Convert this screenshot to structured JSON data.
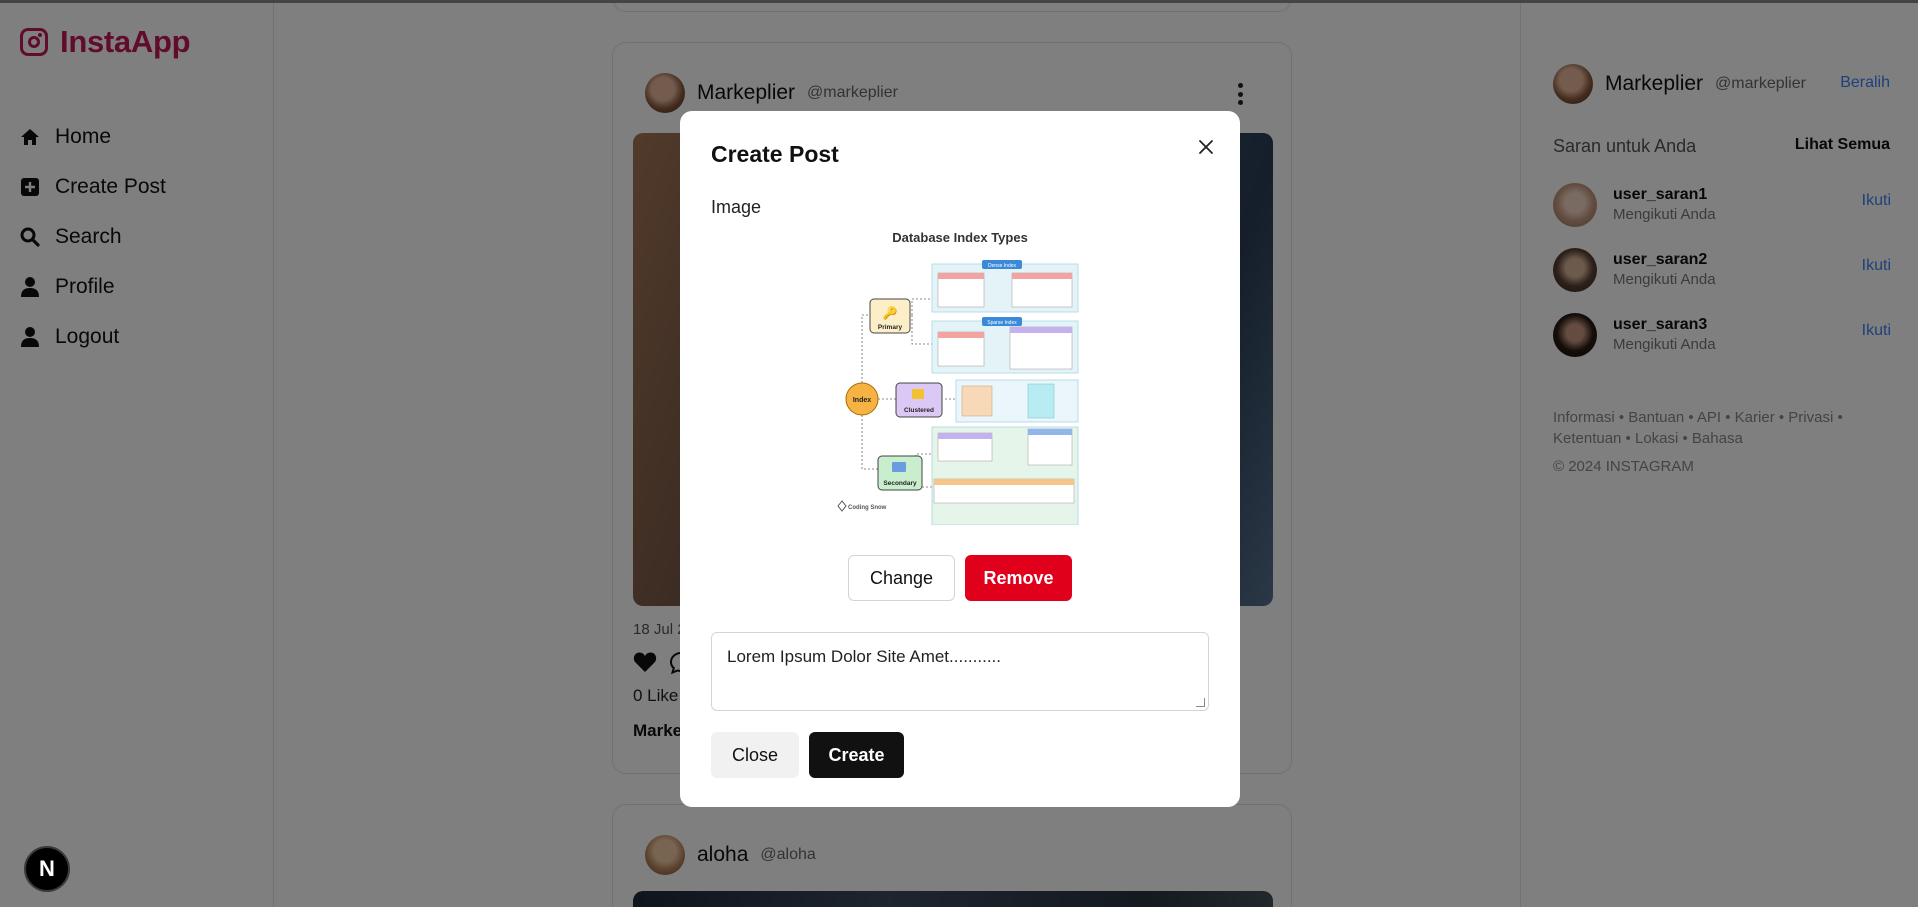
{
  "app": {
    "name": "InstaApp",
    "brand_color": "#c2185b"
  },
  "nav": {
    "items": [
      {
        "label": "Home",
        "icon": "home-icon"
      },
      {
        "label": "Create Post",
        "icon": "plus-square-icon"
      },
      {
        "label": "Search",
        "icon": "search-icon"
      },
      {
        "label": "Profile",
        "icon": "user-icon"
      },
      {
        "label": "Logout",
        "icon": "user-icon"
      }
    ]
  },
  "dev_badge": {
    "label": "N"
  },
  "feed": {
    "post1": {
      "user": "Markeplier",
      "handle": "@markeplier",
      "date": "18 Jul 2",
      "likes": "0 Like",
      "caption_user": "Marke"
    },
    "post2": {
      "user": "aloha",
      "handle": "@aloha"
    }
  },
  "right_panel": {
    "current_user": {
      "name": "Markeplier",
      "handle": "@markeplier",
      "switch_label": "Beralih"
    },
    "suggestions_title": "Saran untuk Anda",
    "see_all_label": "Lihat Semua",
    "suggestions": [
      {
        "username": "user_saran1",
        "subtitle": "Mengikuti Anda",
        "action": "Ikuti"
      },
      {
        "username": "user_saran2",
        "subtitle": "Mengikuti Anda",
        "action": "Ikuti"
      },
      {
        "username": "user_saran3",
        "subtitle": "Mengikuti Anda",
        "action": "Ikuti"
      }
    ],
    "footer_links": "Informasi • Bantuan • API • Karier • Privasi • Ketentuan • Lokasi • Bahasa",
    "copyright": "© 2024 INSTAGRAM",
    "link_color": "#3b82f6"
  },
  "modal": {
    "title": "Create Post",
    "image_label": "Image",
    "preview": {
      "title": "Database Index Types",
      "labels": [
        "Index",
        "Primary",
        "Clustered",
        "Secondary",
        "Dense Index",
        "Sparse Index"
      ],
      "watermark": "Coding Snow"
    },
    "change_label": "Change",
    "remove_label": "Remove",
    "caption_value": "Lorem Ipsum Dolor Site Amet...........",
    "close_label": "Close",
    "create_label": "Create",
    "remove_color": "#e0001b"
  }
}
